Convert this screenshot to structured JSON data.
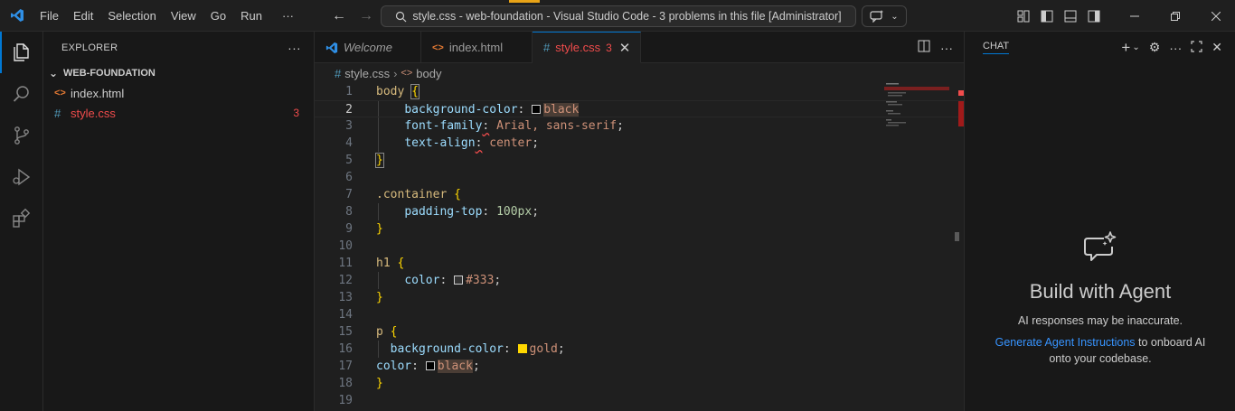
{
  "menu": [
    "File",
    "Edit",
    "Selection",
    "View",
    "Go",
    "Run",
    "···"
  ],
  "command_center": "style.css - web-foundation - Visual Studio Code - 3 problems in this file [Administrator]",
  "sidebar": {
    "title": "EXPLORER",
    "more": "···",
    "folder": "WEB-FOUNDATION",
    "files": [
      {
        "icon": "<>",
        "name": "index.html",
        "badge": ""
      },
      {
        "icon": "#",
        "name": "style.css",
        "badge": "3"
      }
    ]
  },
  "tabs": [
    {
      "icon": "vscode",
      "label": "Welcome"
    },
    {
      "icon": "<>",
      "label": "index.html"
    },
    {
      "icon": "#",
      "label": "style.css",
      "badge": "3"
    }
  ],
  "breadcrumb": {
    "file": "style.css",
    "symbol": "body"
  },
  "code_lines": [
    "1",
    "2",
    "3",
    "4",
    "5",
    "6",
    "7",
    "8",
    "9",
    "10",
    "11",
    "12",
    "13",
    "14",
    "15",
    "16",
    "17",
    "18",
    "19"
  ],
  "code": {
    "l1_sel": "body",
    "l2_prop": "background-color",
    "l2_val": "black",
    "l3_prop": "font-family",
    "l3_val": "Arial, sans-serif",
    "l4_prop": "text-align",
    "l4_val": "center",
    "l7_sel": ".container",
    "l8_prop": "padding-top",
    "l8_val": "100px",
    "l11_sel": "h1",
    "l12_prop": "color",
    "l12_val": "#333",
    "l15_sel": "p",
    "l16_prop": "background-color",
    "l16_val": "gold",
    "l17_prop": "color",
    "l17_val": "black"
  },
  "colors": {
    "accent": "#0078d4",
    "error": "#f14c4c",
    "gold": "#ffd700",
    "black": "#000000",
    "gray333": "#333333"
  },
  "chat": {
    "title": "CHAT",
    "heading": "Build with Agent",
    "subtitle": "AI responses may be inaccurate.",
    "link": "Generate Agent Instructions",
    "desc_rest": " to onboard AI",
    "desc_line2": "onto your codebase."
  }
}
